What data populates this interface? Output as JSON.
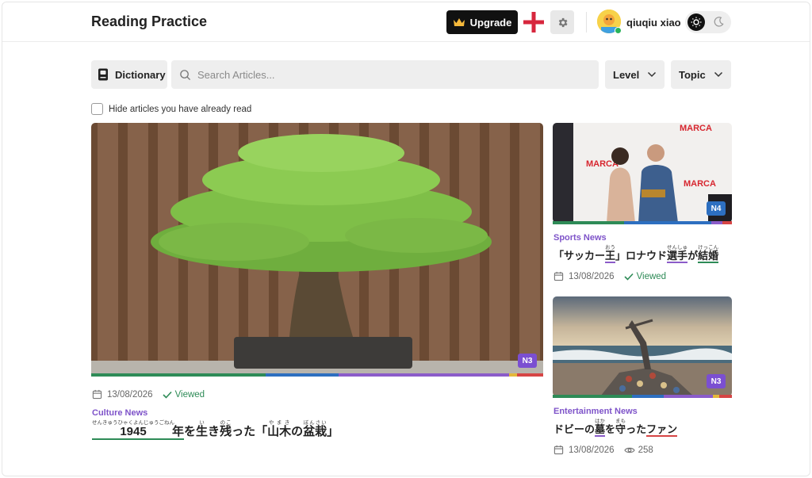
{
  "header": {
    "title": "Reading Practice",
    "upgrade_label": "Upgrade",
    "user_name": "qiuqiu xiao",
    "icons": [
      "crown-icon",
      "england-flag-icon",
      "gear-icon",
      "avatar",
      "sun-icon",
      "moon-icon"
    ]
  },
  "toolbar": {
    "dictionary_label": "Dictionary",
    "search_placeholder": "Search Articles...",
    "level_label": "Level",
    "topic_label": "Topic",
    "hide_read_label": "Hide articles you have already read"
  },
  "colors": {
    "accent_purple": "#7e53c9",
    "viewed_green": "#2e8b57",
    "n3_badge": "#7b4fd1",
    "n4_badge": "#2d6fc0"
  },
  "articles": [
    {
      "category": "Culture News",
      "date": "13/08/2026",
      "status": "Viewed",
      "level": "N3",
      "title_parts": {
        "p1": "1945",
        "p1_ruby": "せんきゅうひゃくよんじゅうごねん",
        "p2": "年",
        "p3": "を",
        "p4": "生",
        "p4_ruby": "い",
        "p5": "き",
        "p6": "残",
        "p6_ruby": "のこ",
        "p7": "った「",
        "p8": "山木",
        "p8_ruby": "やまき",
        "p9": "の",
        "p10": "盆栽",
        "p10_ruby": "ぼんさい",
        "p11": "」"
      }
    },
    {
      "category": "Sports News",
      "date": "13/08/2026",
      "status": "Viewed",
      "level": "N4",
      "title_parts": {
        "p1": "「サッカー",
        "p2": "王",
        "p2_ruby": "おう",
        "p3": "」ロナウド",
        "p4": "選手",
        "p4_ruby": "せんしゅ",
        "p5": "が",
        "p6": "結婚",
        "p6_ruby": "けっこん"
      }
    },
    {
      "category": "Entertainment News",
      "date": "13/08/2026",
      "views": "258",
      "level": "N3",
      "title_parts": {
        "p1": "ドビーの",
        "p2": "墓",
        "p2_ruby": "はか",
        "p3": "を",
        "p4": "守",
        "p4_ruby": "まも",
        "p5": "った",
        "p6": "ファン"
      }
    }
  ]
}
